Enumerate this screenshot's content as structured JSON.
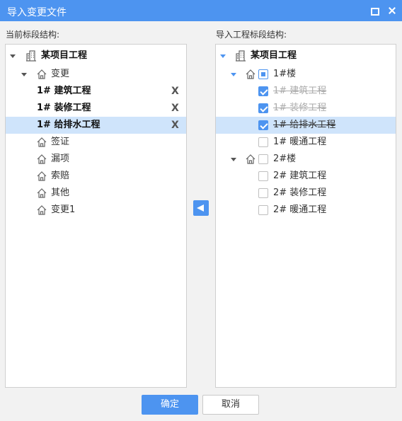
{
  "window": {
    "title": "导入变更文件"
  },
  "left_pane": {
    "label": "当前标段结构:",
    "root": {
      "label": "某项目工程"
    },
    "group": {
      "label": "变更"
    },
    "items": [
      {
        "label": "1# 建筑工程",
        "delete": "X"
      },
      {
        "label": "1# 装修工程",
        "delete": "X"
      },
      {
        "label": "1# 给排水工程",
        "delete": "X"
      }
    ],
    "others": [
      {
        "label": "签证"
      },
      {
        "label": "漏项"
      },
      {
        "label": "索赔"
      },
      {
        "label": "其他"
      },
      {
        "label": "变更1"
      }
    ]
  },
  "right_pane": {
    "label": "导入工程标段结构:",
    "root": {
      "label": "某项目工程"
    },
    "building1": {
      "label": "1#楼",
      "children": [
        {
          "label": "1# 建筑工程",
          "checked": true
        },
        {
          "label": "1# 装修工程",
          "checked": true
        },
        {
          "label": "1# 给排水工程",
          "checked": true
        },
        {
          "label": "1# 暖通工程",
          "checked": false
        }
      ]
    },
    "building2": {
      "label": "2#楼",
      "children": [
        {
          "label": "2# 建筑工程",
          "checked": false
        },
        {
          "label": "2# 装修工程",
          "checked": false
        },
        {
          "label": "2# 暖通工程",
          "checked": false
        }
      ]
    }
  },
  "buttons": {
    "ok": "确定",
    "cancel": "取消"
  },
  "colors": {
    "accent": "#4d94f0",
    "selected_row": "#cfe4fb"
  }
}
